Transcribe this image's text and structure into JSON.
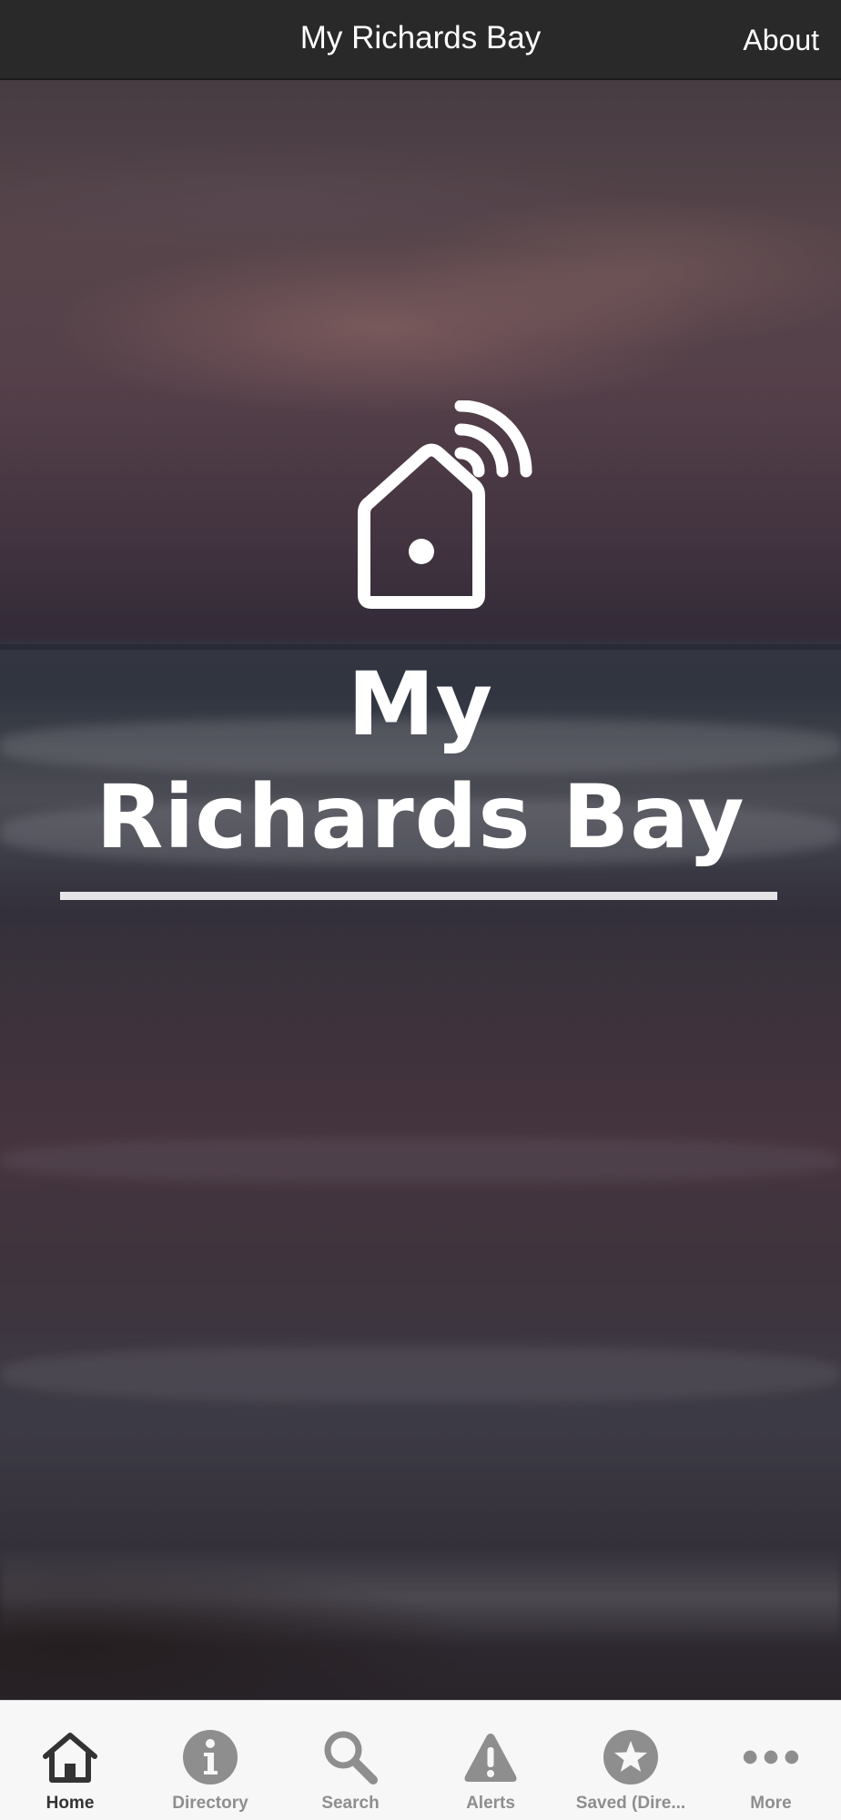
{
  "header": {
    "title": "My Richards Bay",
    "about_label": "About"
  },
  "hero": {
    "logo_icon": "smart-home-wifi-icon",
    "title_line1": "My",
    "title_line2": "Richards Bay"
  },
  "tabbar": {
    "active": "Home",
    "tabs": [
      {
        "label": "Home",
        "icon": "home-icon"
      },
      {
        "label": "Directory",
        "icon": "info-icon"
      },
      {
        "label": "Search",
        "icon": "search-icon"
      },
      {
        "label": "Alerts",
        "icon": "alert-icon"
      },
      {
        "label": "Saved (Dire...",
        "icon": "star-icon"
      },
      {
        "label": "More",
        "icon": "more-icon"
      }
    ]
  },
  "colors": {
    "header_bg": "#282828",
    "tabbar_bg": "#f7f7f7",
    "tab_active": "#333333",
    "tab_inactive": "#8e8e8e"
  }
}
